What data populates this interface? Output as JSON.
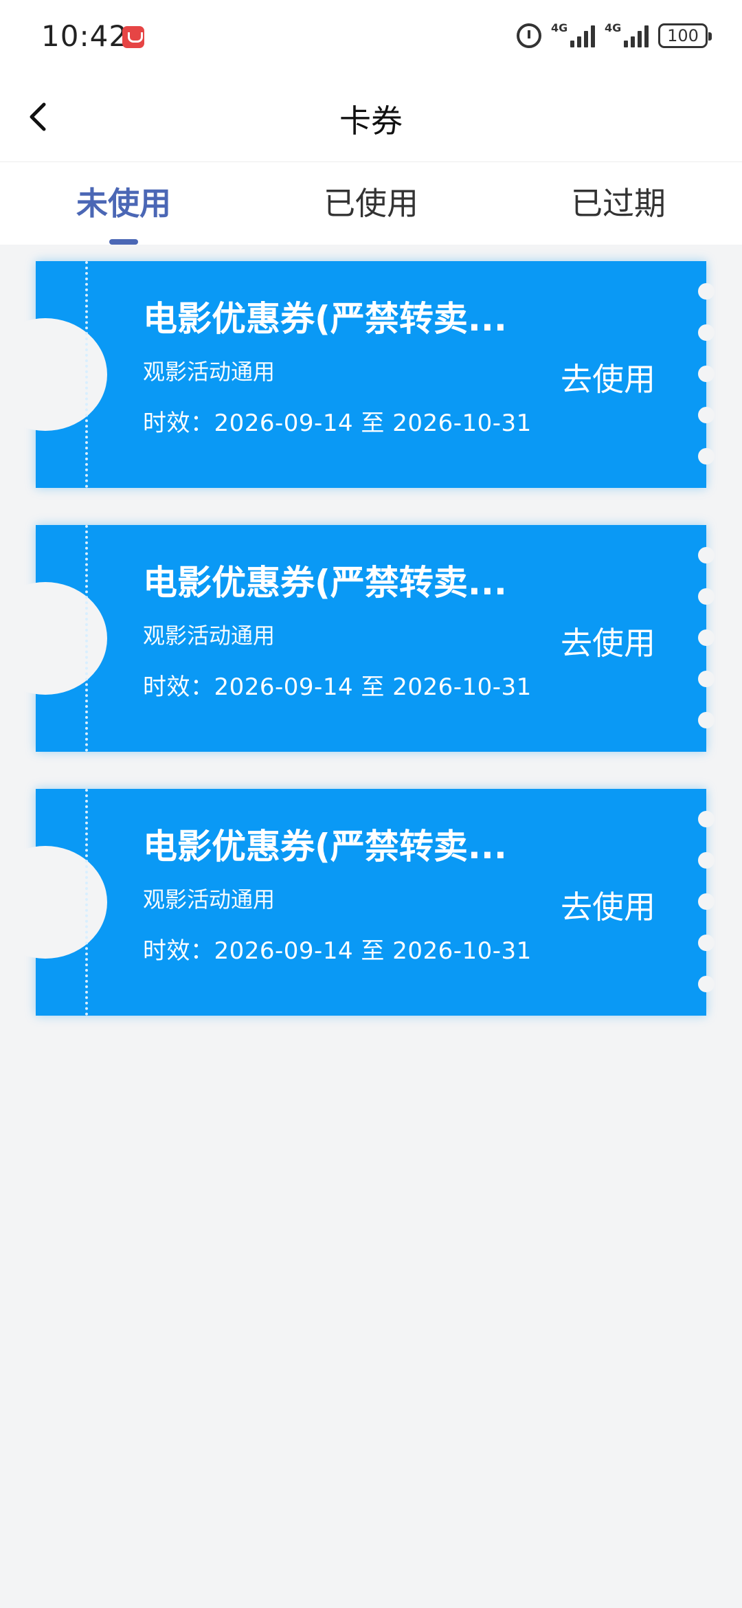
{
  "status_bar": {
    "time": "10:42",
    "network_1": "4G",
    "network_2": "4G",
    "battery": "100"
  },
  "nav": {
    "title": "卡券"
  },
  "tabs": [
    {
      "label": "未使用",
      "active": true
    },
    {
      "label": "已使用",
      "active": false
    },
    {
      "label": "已过期",
      "active": false
    }
  ],
  "coupons": [
    {
      "title": "电影优惠券(严禁转卖...",
      "subtitle": "观影活动通用",
      "validity": "时效：2026-09-14 至 2026-10-31",
      "action": "去使用"
    },
    {
      "title": "电影优惠券(严禁转卖...",
      "subtitle": "观影活动通用",
      "validity": "时效：2026-09-14 至 2026-10-31",
      "action": "去使用"
    },
    {
      "title": "电影优惠券(严禁转卖...",
      "subtitle": "观影活动通用",
      "validity": "时效：2026-09-14 至 2026-10-31",
      "action": "去使用"
    }
  ],
  "colors": {
    "coupon_bg": "#0a99f5",
    "tab_active": "#4b67b5",
    "page_bg": "#f3f4f5"
  },
  "icons": {
    "back": "chevron-left-icon",
    "alarm": "alarm-icon",
    "signal": "signal-icon",
    "battery": "battery-icon"
  }
}
